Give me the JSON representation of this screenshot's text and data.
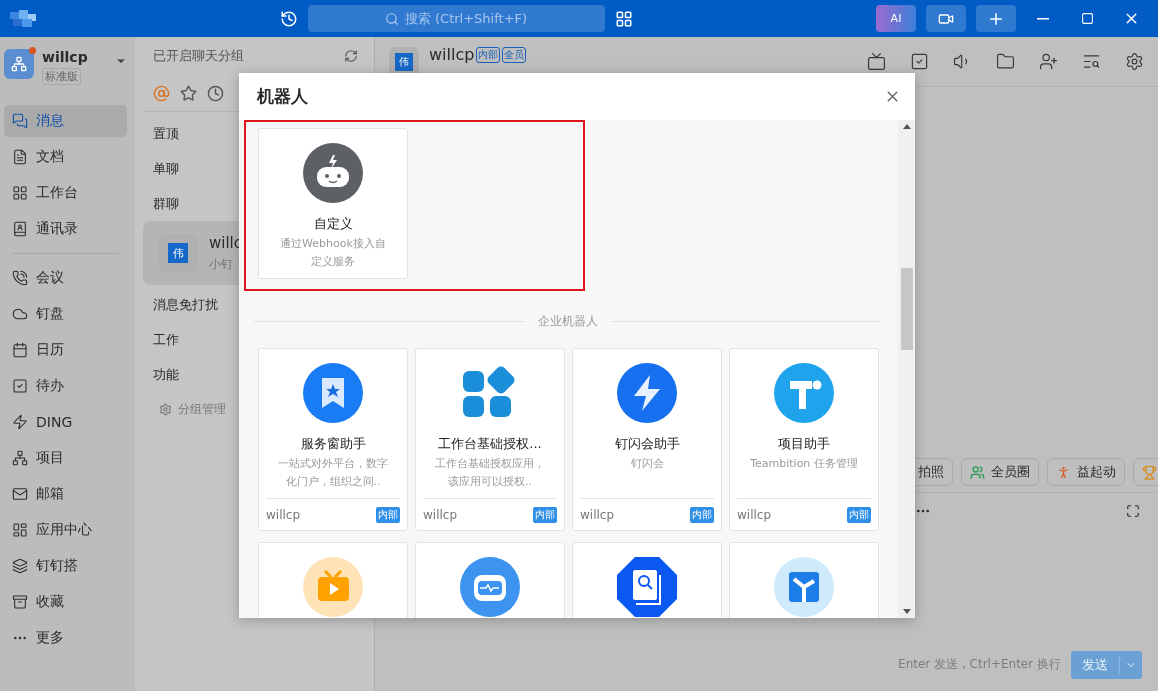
{
  "titlebar": {
    "search_placeholder": "搜索 (Ctrl+Shift+F)",
    "ai_label": "AI"
  },
  "sidebar": {
    "account": {
      "name": "willcp",
      "plan": "标准版",
      "unread": true
    },
    "primary_items": [
      {
        "label": "消息",
        "selected": true
      },
      {
        "label": "文档",
        "selected": false
      },
      {
        "label": "工作台",
        "selected": false
      },
      {
        "label": "通讯录",
        "selected": false
      }
    ],
    "secondary_items": [
      {
        "label": "会议",
        "selected": false
      },
      {
        "label": "钉盘",
        "selected": false
      },
      {
        "label": "日历",
        "selected": false
      },
      {
        "label": "待办",
        "selected": false
      },
      {
        "label": "DING",
        "selected": false
      },
      {
        "label": "项目",
        "selected": false
      },
      {
        "label": "邮箱",
        "selected": false
      },
      {
        "label": "应用中心",
        "selected": false
      },
      {
        "label": "钉钉搭",
        "selected": false
      },
      {
        "label": "收藏",
        "selected": false
      },
      {
        "label": "更多",
        "selected": false
      }
    ]
  },
  "chat_list": {
    "header": "已开启聊天分组",
    "groups": [
      "置顶",
      "单聊",
      "群聊"
    ],
    "chat": {
      "avatar": "伟",
      "name": "willc",
      "preview": "小钉",
      "selected": true
    },
    "more_groups": [
      "消息免打扰",
      "工作",
      "功能"
    ],
    "manage": "分组管理"
  },
  "chat": {
    "avatar": "伟",
    "name": "willcp",
    "tags": [
      "内部",
      "全员"
    ],
    "chips": [
      {
        "label": "拍照",
        "kind": "text"
      },
      {
        "label": "全员圈",
        "kind": "circle"
      },
      {
        "label": "益起动",
        "kind": "runner"
      },
      {
        "kind": "trophy"
      }
    ],
    "hint": "Enter 发送 , Ctrl+Enter 换行",
    "send": "发送",
    "send_disabled": true
  },
  "modal": {
    "title": "机器人",
    "custom": {
      "name": "自定义",
      "description": "通过Webhook接入自定义服务",
      "highlighted": true
    },
    "section": "企业机器人",
    "robots": [
      {
        "kind": "full",
        "name": "服务窗助手",
        "description": "一站式对外平台，数字化门户，组织之间..",
        "owner": "willcp",
        "badge": "内部"
      },
      {
        "kind": "full",
        "name": "工作台基础授权...",
        "description": "工作台基础授权应用，该应用可以授权..",
        "owner": "willcp",
        "badge": "内部"
      },
      {
        "kind": "full",
        "name": "钉闪会助手",
        "description": "钉闪会",
        "owner": "willcp",
        "badge": "内部"
      },
      {
        "kind": "full",
        "name": "项目助手",
        "description": "Teambition 任务管理",
        "owner": "willcp",
        "badge": "内部"
      },
      {
        "kind": "icon_only"
      },
      {
        "kind": "icon_only"
      },
      {
        "kind": "icon_only"
      },
      {
        "kind": "icon_only"
      }
    ]
  }
}
